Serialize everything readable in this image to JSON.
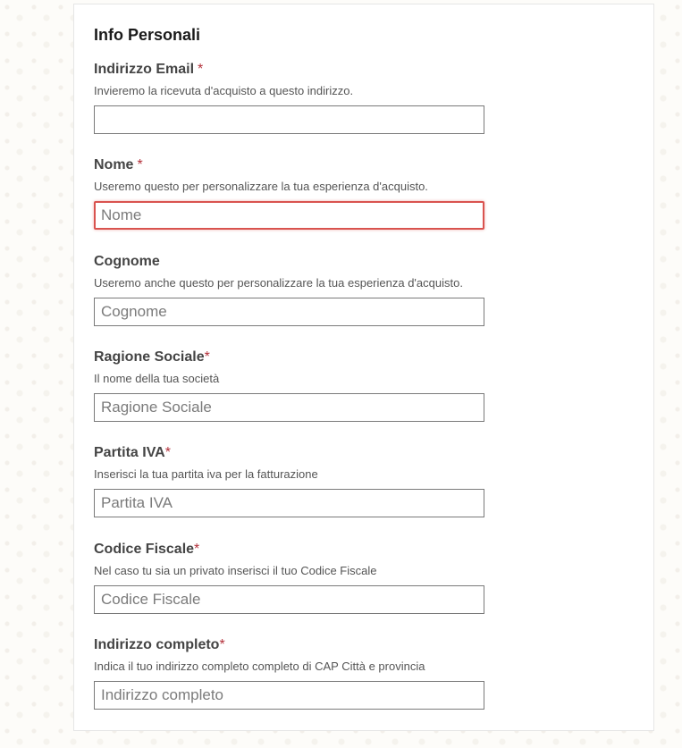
{
  "form": {
    "title": "Info Personali",
    "fields": [
      {
        "label": "Indirizzo Email",
        "required_mark": "*",
        "help": "Invieremo la ricevuta d'acquisto a questo indirizzo.",
        "placeholder": "",
        "value": "",
        "state": "normal"
      },
      {
        "label": "Nome",
        "required_mark": "*",
        "help": "Useremo questo per personalizzare la tua esperienza d'acquisto.",
        "placeholder": "Nome",
        "value": "",
        "state": "error"
      },
      {
        "label": "Cognome",
        "required_mark": "",
        "help": "Useremo anche questo per personalizzare la tua esperienza d'acquisto.",
        "placeholder": "Cognome",
        "value": "",
        "state": "normal"
      },
      {
        "label": "Ragione Sociale",
        "required_mark": "*",
        "help": "Il nome della tua società",
        "placeholder": "Ragione Sociale",
        "value": "",
        "state": "normal"
      },
      {
        "label": "Partita IVA",
        "required_mark": "*",
        "help": "Inserisci la tua partita iva per la fatturazione",
        "placeholder": "Partita IVA",
        "value": "",
        "state": "normal"
      },
      {
        "label": "Codice Fiscale",
        "required_mark": "*",
        "help": "Nel caso tu sia un privato inserisci il tuo Codice Fiscale",
        "placeholder": "Codice Fiscale",
        "value": "",
        "state": "normal"
      },
      {
        "label": "Indirizzo completo",
        "required_mark": "*",
        "help": "Indica il tuo indirizzo completo completo di CAP Città e provincia",
        "placeholder": "Indirizzo completo",
        "value": "",
        "state": "normal"
      }
    ]
  },
  "colors": {
    "required_mark": "#b3313b",
    "error_border": "#d9534f",
    "input_border": "#7a7a7a"
  }
}
